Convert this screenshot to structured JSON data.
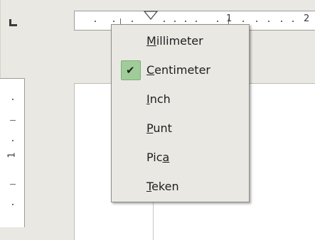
{
  "ruler": {
    "numbers": [
      "1",
      "2"
    ],
    "vertical_number": "1"
  },
  "menu": {
    "items": [
      {
        "pre": "",
        "mnemonic": "M",
        "post": "illimeter",
        "checked": false
      },
      {
        "pre": "",
        "mnemonic": "C",
        "post": "entimeter",
        "checked": true
      },
      {
        "pre": "",
        "mnemonic": "I",
        "post": "nch",
        "checked": false
      },
      {
        "pre": "",
        "mnemonic": "P",
        "post": "unt",
        "checked": false
      },
      {
        "pre": "Pic",
        "mnemonic": "a",
        "post": "",
        "checked": false
      },
      {
        "pre": "",
        "mnemonic": "T",
        "post": "eken",
        "checked": false
      }
    ],
    "check_symbol": "✔"
  },
  "colors": {
    "menu_bg": "#eae8e3",
    "checked_highlight": "#9fcc98"
  }
}
